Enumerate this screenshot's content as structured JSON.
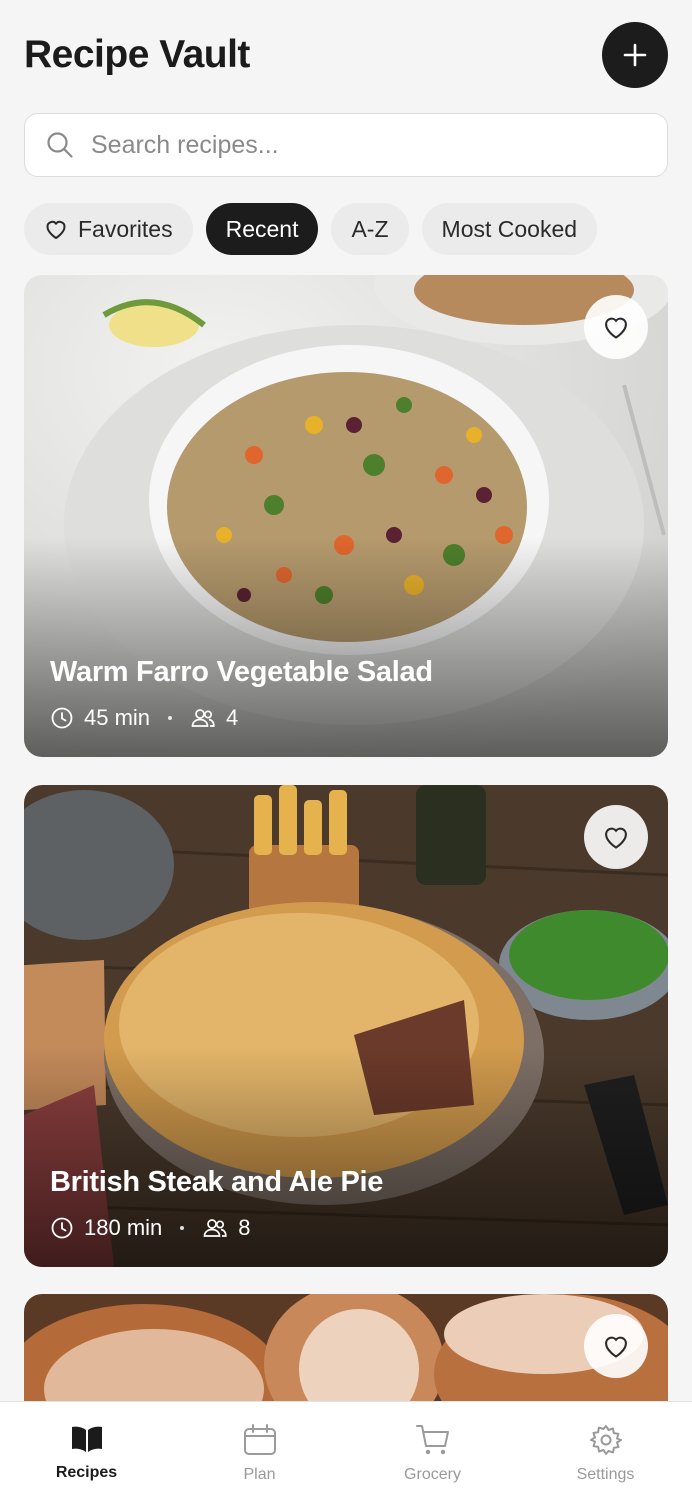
{
  "header": {
    "title": "Recipe Vault",
    "add_icon": "plus-icon"
  },
  "search": {
    "placeholder": "Search recipes...",
    "value": ""
  },
  "filters": [
    {
      "label": "Favorites",
      "icon": "heart-outline-icon",
      "active": false
    },
    {
      "label": "Recent",
      "active": true
    },
    {
      "label": "A-Z",
      "active": false
    },
    {
      "label": "Most Cooked",
      "active": false
    }
  ],
  "recipes": [
    {
      "title": "Warm Farro Vegetable Salad",
      "time": "45 min",
      "servings": "4",
      "favorite": false
    },
    {
      "title": "British Steak and Ale Pie",
      "time": "180 min",
      "servings": "8",
      "favorite": false
    },
    {
      "title": "",
      "favorite": false
    }
  ],
  "tabs": [
    {
      "label": "Recipes",
      "icon": "open-book-icon",
      "active": true
    },
    {
      "label": "Plan",
      "icon": "calendar-icon",
      "active": false
    },
    {
      "label": "Grocery",
      "icon": "shopping-cart-icon",
      "active": false
    },
    {
      "label": "Settings",
      "icon": "gear-icon",
      "active": false
    }
  ],
  "colors": {
    "accent": "#1c1c1c",
    "background": "#f5f5f5",
    "inactive": "#9a9a9a"
  }
}
